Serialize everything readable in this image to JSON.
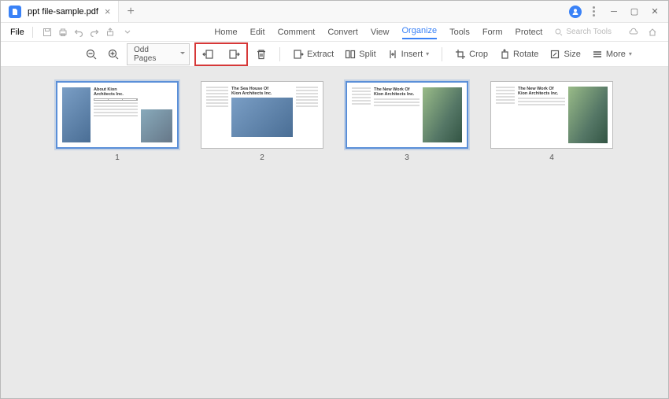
{
  "tab": {
    "title": "ppt file-sample.pdf"
  },
  "file_menu": "File",
  "main_menu": [
    "Home",
    "Edit",
    "Comment",
    "Convert",
    "View",
    "Organize",
    "Tools",
    "Form",
    "Protect"
  ],
  "active_menu_index": 5,
  "search_placeholder": "Search Tools",
  "toolbar": {
    "filter": "Odd Pages",
    "extract": "Extract",
    "split": "Split",
    "insert": "Insert",
    "crop": "Crop",
    "rotate": "Rotate",
    "size": "Size",
    "more": "More"
  },
  "pages": [
    {
      "num": "1",
      "selected": true,
      "title_l1": "About Kion",
      "title_l2": "Architects Inc."
    },
    {
      "num": "2",
      "selected": false,
      "title_l1": "The Sea House Of",
      "title_l2": "Kion Architects Inc."
    },
    {
      "num": "3",
      "selected": true,
      "title_l1": "The New Work Of",
      "title_l2": "Kion Architects Inc."
    },
    {
      "num": "4",
      "selected": false,
      "title_l1": "The New Work Of",
      "title_l2": "Kion Architects Inc."
    }
  ]
}
